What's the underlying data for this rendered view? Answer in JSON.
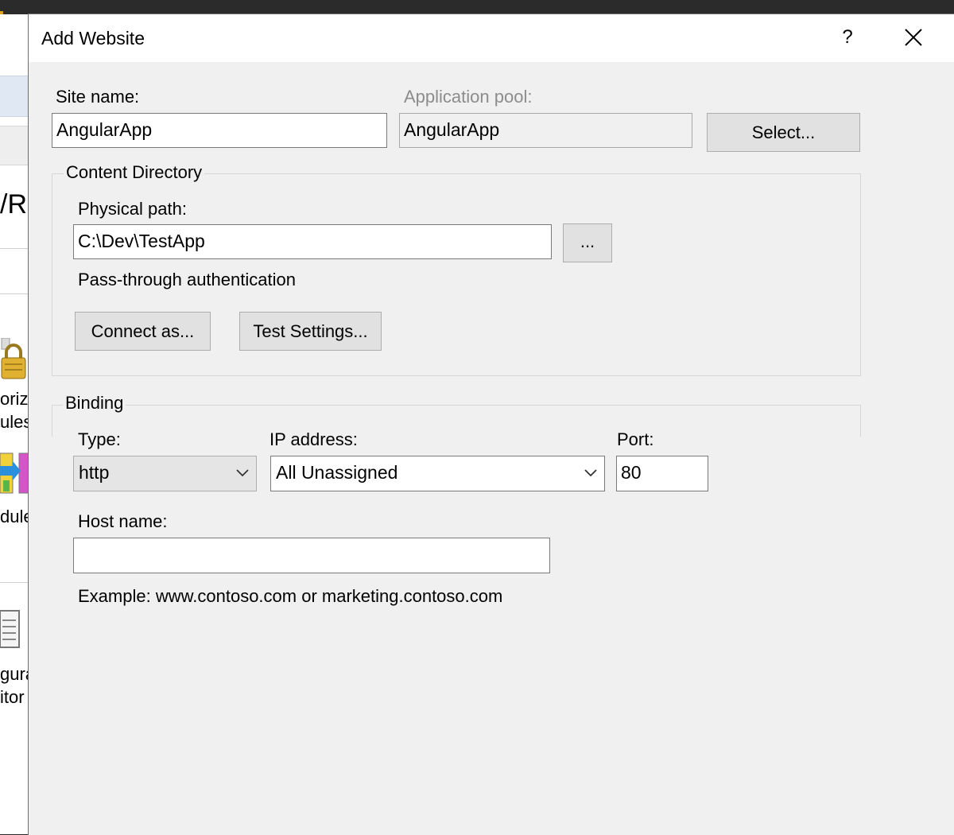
{
  "dialog": {
    "title": "Add Website",
    "help_label": "?"
  },
  "site": {
    "site_name_label": "Site name:",
    "site_name_value": "AngularApp",
    "app_pool_label": "Application pool:",
    "app_pool_value": "AngularApp",
    "select_label": "Select..."
  },
  "content_directory": {
    "group_title": "Content Directory",
    "physical_path_label": "Physical path:",
    "physical_path_value": "C:\\Dev\\TestApp",
    "browse_label": "...",
    "passthrough_label": "Pass-through authentication",
    "connect_as_label": "Connect as...",
    "test_settings_label": "Test Settings..."
  },
  "binding": {
    "group_title": "Binding",
    "type_label": "Type:",
    "type_value": "http",
    "ip_label": "IP address:",
    "ip_value": "All Unassigned",
    "port_label": "Port:",
    "port_value": "80",
    "host_label": "Host name:",
    "host_value": "",
    "example_text": "Example: www.contoso.com or marketing.contoso.com"
  },
  "background": {
    "heading_fragment": "/R",
    "item1_line1": "oriza",
    "item1_line2": "ules",
    "item2_line1": "dule",
    "item3_line1": "gura",
    "item3_line2": "itor"
  },
  "icons": {
    "help": "question-mark-icon",
    "close": "close-icon",
    "dropdown": "chevron-down-icon",
    "bg_lock": "lock-icon",
    "bg_modules": "modules-icon",
    "bg_editor": "document-icon"
  }
}
